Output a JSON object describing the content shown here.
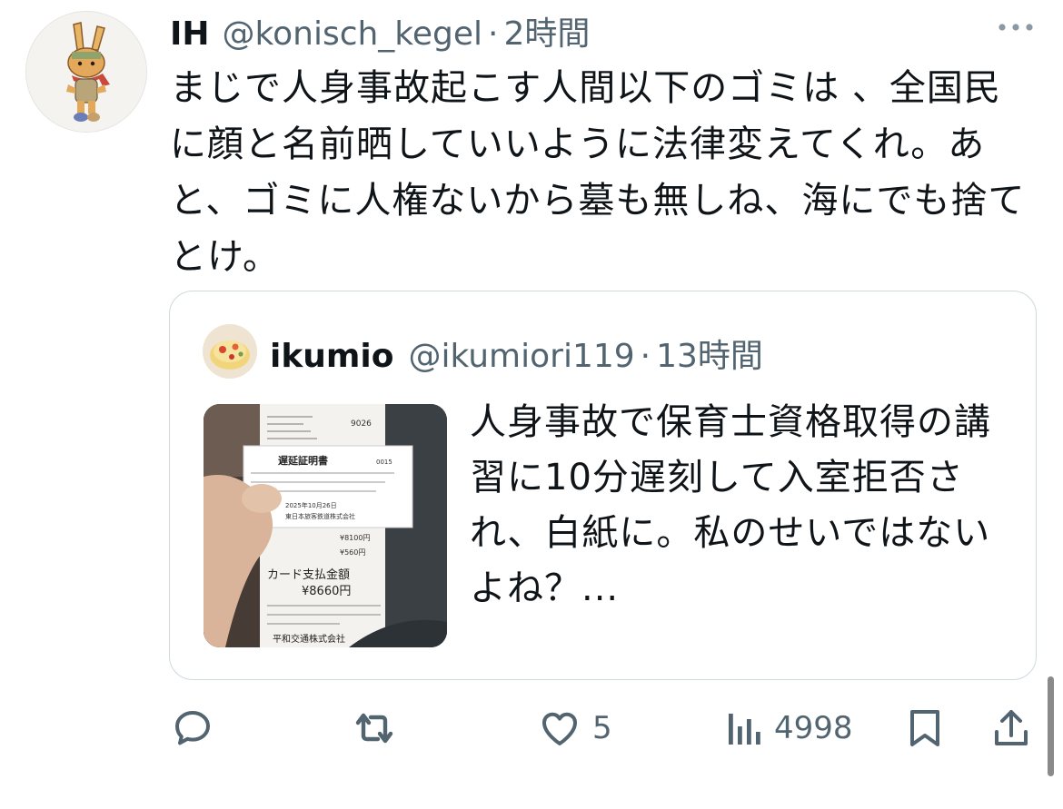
{
  "tweet": {
    "author_name": "IH",
    "author_handle": "@konisch_kegel",
    "separator": "·",
    "time": "2時間",
    "avatar_icon": "rabbit-character-avatar",
    "text": "まじで人身事故起こす人間以下のゴミは 、全国民に顔と名前晒していいように法律変えてくれ。あと、ゴミに人権ないから墓も無しね、海にでも捨てとけ。"
  },
  "quote": {
    "author_name": "ikumio",
    "author_handle": "@ikumiori119",
    "separator": "·",
    "time": "13時間",
    "avatar_icon": "food-photo-avatar",
    "text": "人身事故で保育士資格取得の講習に10分遅刻して入室拒否され、白紙に。私のせいではないよね？...",
    "image": {
      "certificate_title": "遅延証明書",
      "certificate_number": "0015",
      "certificate_date": "2025年10月26日",
      "certificate_company": "東日本旅客鉄道株式会社",
      "receipt_number": "9026",
      "receipt_card_label": "カード支払金額",
      "receipt_amount": "¥8660円",
      "receipt_fare": "¥8100円",
      "receipt_toll": "¥560円",
      "receipt_company": "平和交通株式会社"
    }
  },
  "actions": {
    "reply_icon": "reply-icon",
    "retweet_icon": "retweet-icon",
    "like_icon": "heart-icon",
    "like_count": "5",
    "views_icon": "views-icon",
    "views_count": "4998",
    "bookmark_icon": "bookmark-icon",
    "share_icon": "share-icon"
  },
  "colors": {
    "text": "#0f1419",
    "secondary": "#536471",
    "border": "#cfd9de"
  }
}
